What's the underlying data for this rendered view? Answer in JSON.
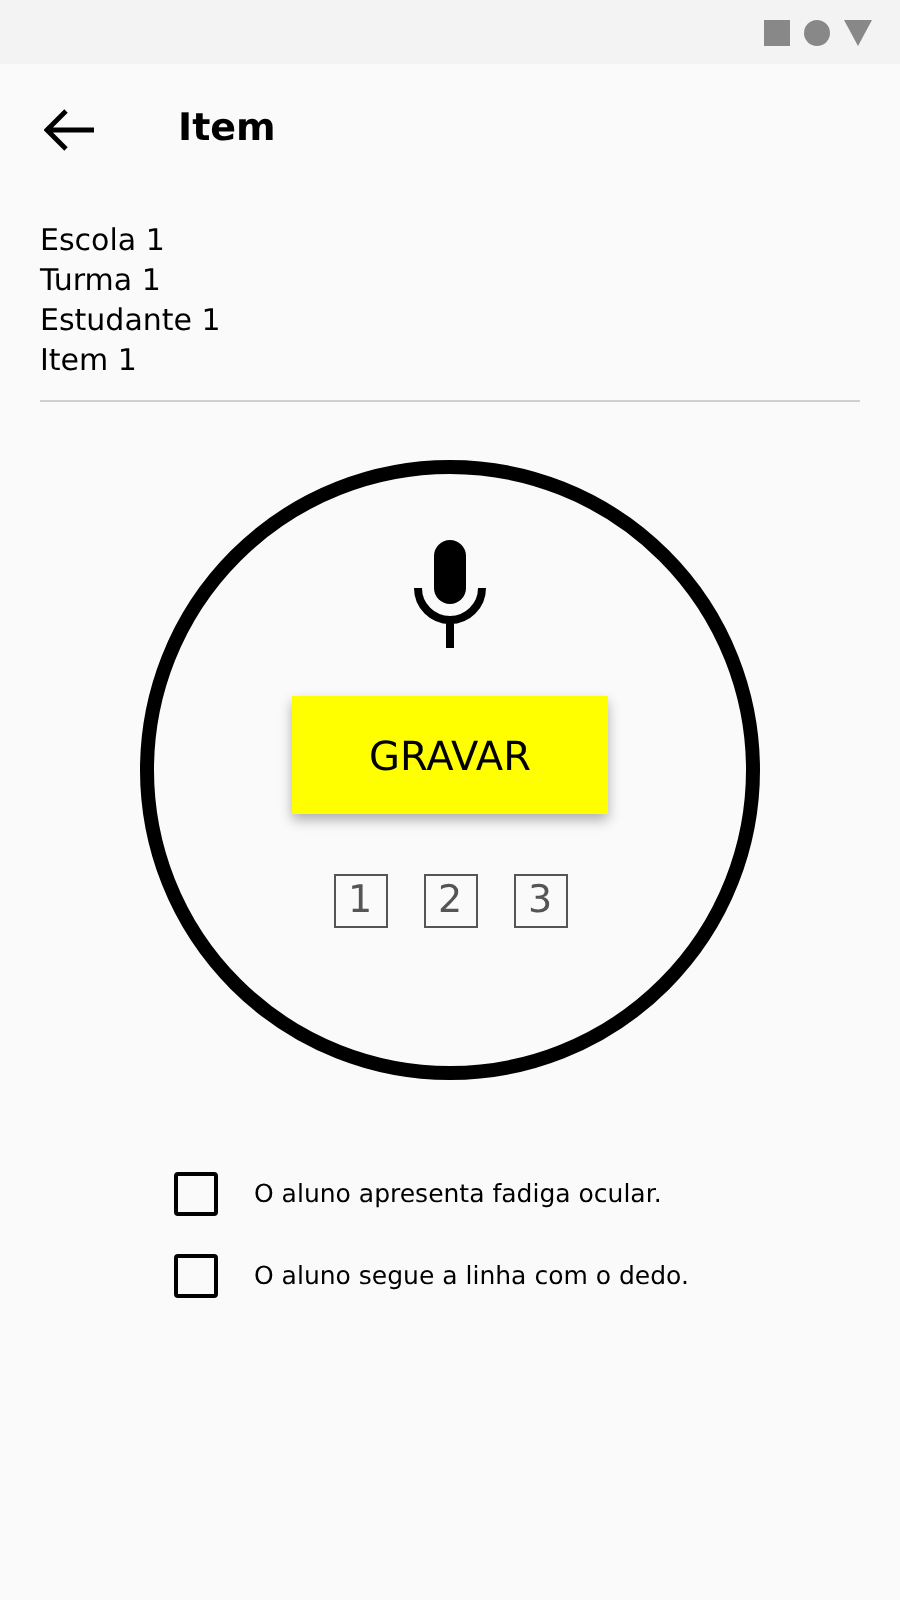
{
  "header": {
    "title": "Item"
  },
  "info_lines": [
    "Escola 1",
    "Turma 1",
    "Estudante 1",
    "Item 1"
  ],
  "record_button": {
    "label": "GRAVAR"
  },
  "attempts": [
    "1",
    "2",
    "3"
  ],
  "observations": [
    {
      "label": "O aluno apresenta fadiga ocular.",
      "checked": false
    },
    {
      "label": "O aluno segue a linha com o dedo.",
      "checked": false
    }
  ]
}
